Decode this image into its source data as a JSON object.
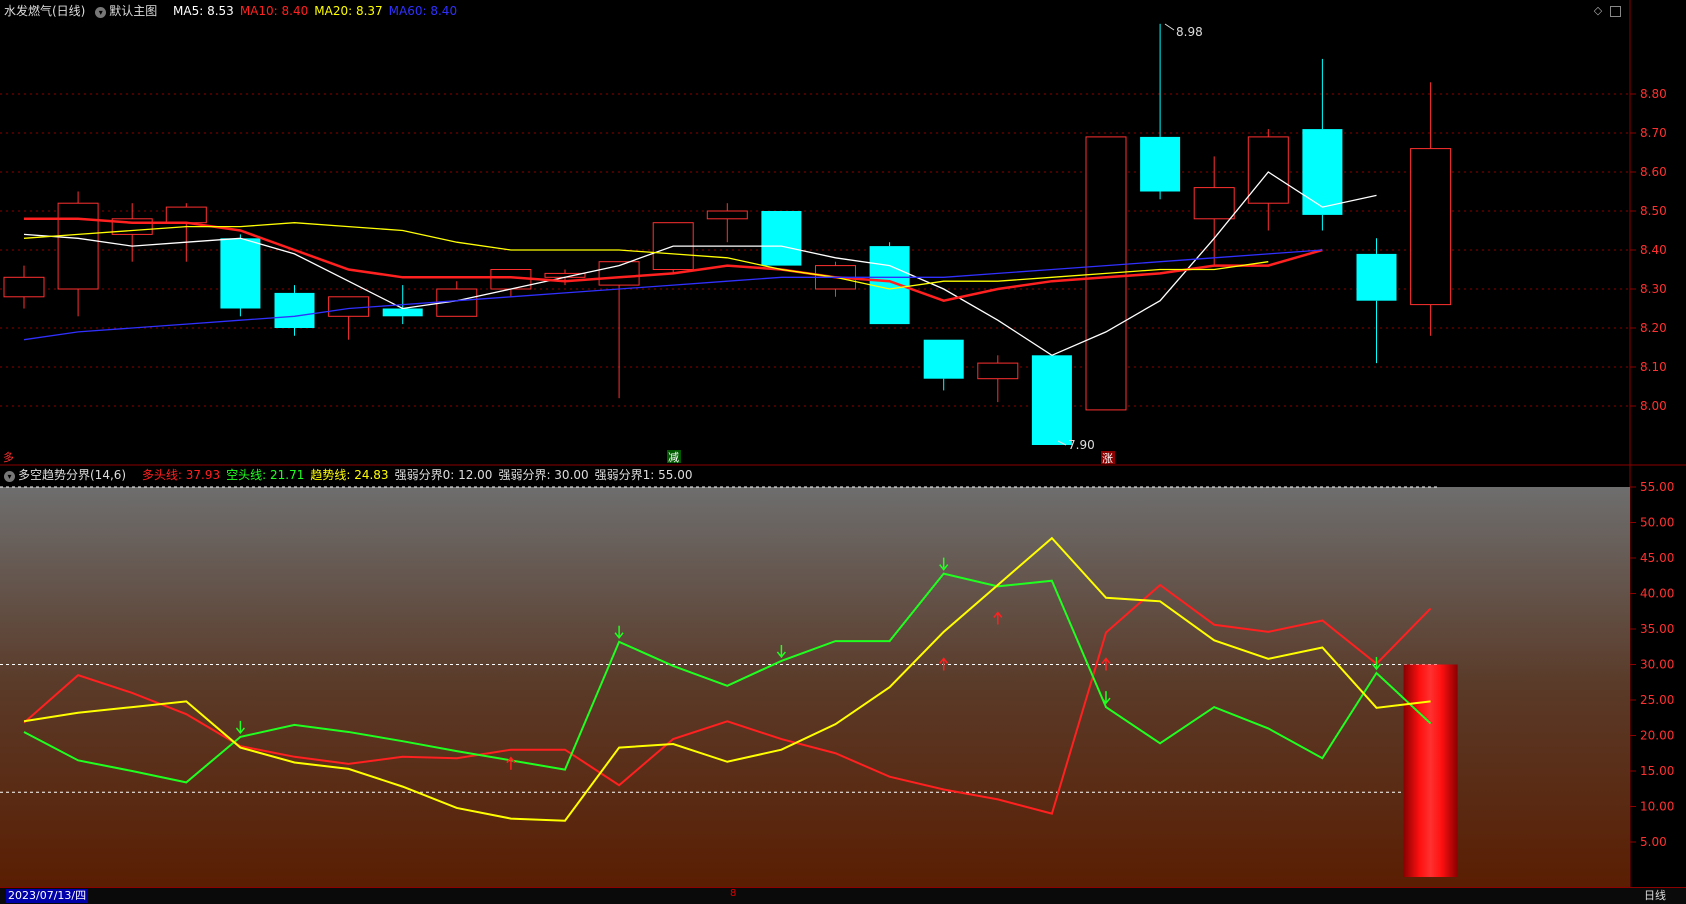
{
  "main_panel": {
    "stock_name": "水发燃气(日线)",
    "template_label": "默认主图",
    "ma": [
      {
        "label": "MA5: 8.53",
        "color": "#ffffff"
      },
      {
        "label": "MA10: 8.40",
        "color": "#ff2020"
      },
      {
        "label": "MA20: 8.37",
        "color": "#ffff00"
      },
      {
        "label": "MA60: 8.40",
        "color": "#3030ff"
      }
    ],
    "high_label": "8.98",
    "low_label": "7.90",
    "marker_left": "多",
    "marker_mid": "减",
    "marker_right": "涨"
  },
  "indicator_panel": {
    "name": "多空趋势分界(14,6)",
    "values": [
      {
        "label": "多头线: 37.93",
        "color": "#ff2020"
      },
      {
        "label": "空头线: 21.71",
        "color": "#20ff20"
      },
      {
        "label": "趋势线: 24.83",
        "color": "#ffff00"
      },
      {
        "label": "强弱分界0: 12.00",
        "color": "#dddddd"
      },
      {
        "label": "强弱分界: 30.00",
        "color": "#dddddd"
      },
      {
        "label": "强弱分界1: 55.00",
        "color": "#dddddd"
      }
    ]
  },
  "bottom": {
    "date": "2023/07/13/四",
    "period": "日线",
    "cursor": "8"
  },
  "colors": {
    "up": "#ff3030",
    "down": "#00ffff",
    "grid": "#8b0000"
  },
  "chart_data": [
    {
      "type": "candlestick",
      "title": "水发燃气(日线)",
      "y_ticks": [
        8.0,
        8.1,
        8.2,
        8.3,
        8.4,
        8.5,
        8.6,
        8.7,
        8.8
      ],
      "ylim": [
        7.88,
        9.0
      ],
      "candles": [
        {
          "o": 8.28,
          "h": 8.36,
          "l": 8.25,
          "c": 8.33
        },
        {
          "o": 8.3,
          "h": 8.55,
          "l": 8.23,
          "c": 8.52
        },
        {
          "o": 8.44,
          "h": 8.52,
          "l": 8.37,
          "c": 8.48
        },
        {
          "o": 8.47,
          "h": 8.52,
          "l": 8.37,
          "c": 8.51
        },
        {
          "o": 8.43,
          "h": 8.44,
          "l": 8.23,
          "c": 8.25
        },
        {
          "o": 8.29,
          "h": 8.31,
          "l": 8.18,
          "c": 8.2
        },
        {
          "o": 8.23,
          "h": 8.28,
          "l": 8.17,
          "c": 8.28
        },
        {
          "o": 8.25,
          "h": 8.31,
          "l": 8.21,
          "c": 8.23
        },
        {
          "o": 8.23,
          "h": 8.32,
          "l": 8.23,
          "c": 8.3
        },
        {
          "o": 8.3,
          "h": 8.35,
          "l": 8.28,
          "c": 8.35
        },
        {
          "o": 8.33,
          "h": 8.35,
          "l": 8.31,
          "c": 8.34
        },
        {
          "o": 8.31,
          "h": 8.37,
          "l": 8.02,
          "c": 8.37
        },
        {
          "o": 8.35,
          "h": 8.47,
          "l": 8.34,
          "c": 8.47
        },
        {
          "o": 8.48,
          "h": 8.52,
          "l": 8.42,
          "c": 8.5
        },
        {
          "o": 8.5,
          "h": 8.5,
          "l": 8.36,
          "c": 8.36
        },
        {
          "o": 8.3,
          "h": 8.37,
          "l": 8.28,
          "c": 8.36
        },
        {
          "o": 8.41,
          "h": 8.42,
          "l": 8.21,
          "c": 8.21
        },
        {
          "o": 8.17,
          "h": 8.17,
          "l": 8.04,
          "c": 8.07
        },
        {
          "o": 8.07,
          "h": 8.13,
          "l": 8.01,
          "c": 8.11
        },
        {
          "o": 8.13,
          "h": 8.13,
          "l": 7.9,
          "c": 7.9
        },
        {
          "o": 7.99,
          "h": 8.69,
          "l": 7.99,
          "c": 8.69
        },
        {
          "o": 8.69,
          "h": 8.98,
          "l": 8.53,
          "c": 8.55
        },
        {
          "o": 8.48,
          "h": 8.64,
          "l": 8.36,
          "c": 8.56
        },
        {
          "o": 8.52,
          "h": 8.71,
          "l": 8.45,
          "c": 8.69
        },
        {
          "o": 8.71,
          "h": 8.89,
          "l": 8.45,
          "c": 8.49
        },
        {
          "o": 8.39,
          "h": 8.43,
          "l": 8.11,
          "c": 8.27
        },
        {
          "o": 8.26,
          "h": 8.83,
          "l": 8.18,
          "c": 8.66
        }
      ],
      "series": [
        {
          "name": "MA5",
          "color": "#ffffff",
          "values": [
            8.44,
            8.43,
            8.41,
            8.42,
            8.43,
            8.39,
            8.32,
            8.25,
            8.27,
            8.3,
            8.33,
            8.36,
            8.41,
            8.41,
            8.41,
            8.38,
            8.36,
            8.3,
            8.22,
            8.13,
            8.19,
            8.27,
            8.43,
            8.6,
            8.51,
            8.54,
            null
          ]
        },
        {
          "name": "MA10",
          "color": "#ff2020",
          "values": [
            8.48,
            8.48,
            8.47,
            8.47,
            8.45,
            8.4,
            8.35,
            8.33,
            8.33,
            8.33,
            8.32,
            8.33,
            8.34,
            8.36,
            8.35,
            8.33,
            8.32,
            8.27,
            8.3,
            8.32,
            8.33,
            8.34,
            8.36,
            8.36,
            8.4,
            null,
            null
          ]
        },
        {
          "name": "MA20",
          "color": "#ffff00",
          "values": [
            8.43,
            8.44,
            8.45,
            8.46,
            8.46,
            8.47,
            8.46,
            8.45,
            8.42,
            8.4,
            8.4,
            8.4,
            8.39,
            8.38,
            8.35,
            8.33,
            8.3,
            8.32,
            8.32,
            8.33,
            8.34,
            8.35,
            8.35,
            8.37,
            null,
            null,
            null
          ]
        },
        {
          "name": "MA60",
          "color": "#3030ff",
          "values": [
            8.17,
            8.19,
            8.2,
            8.21,
            8.22,
            8.23,
            8.25,
            8.26,
            8.27,
            8.28,
            8.29,
            8.3,
            8.31,
            8.32,
            8.33,
            8.33,
            8.33,
            8.33,
            8.34,
            8.35,
            8.36,
            8.37,
            8.38,
            8.39,
            8.4,
            null,
            null
          ]
        }
      ]
    },
    {
      "type": "line",
      "title": "多空趋势分界(14,6)",
      "y_ticks": [
        5.0,
        10.0,
        15.0,
        20.0,
        25.0,
        30.0,
        35.0,
        40.0,
        45.0,
        50.0,
        55.0
      ],
      "ylim": [
        0,
        55
      ],
      "reference_lines": [
        12,
        30,
        55
      ],
      "series": [
        {
          "name": "多头线",
          "color": "#ff2020",
          "values": [
            21.8,
            28.5,
            26.0,
            23.0,
            18.5,
            17.0,
            16.0,
            17.0,
            16.8,
            18.0,
            18.0,
            13.0,
            19.5,
            22.0,
            19.5,
            17.5,
            14.2,
            12.4,
            11.0,
            9.0,
            34.5,
            41.2,
            35.6,
            34.6,
            36.2,
            30.1,
            37.9
          ]
        },
        {
          "name": "空头线",
          "color": "#20ff20",
          "values": [
            20.5,
            16.5,
            15.0,
            13.4,
            19.8,
            21.5,
            20.5,
            19.2,
            17.8,
            16.5,
            15.2,
            33.2,
            29.8,
            27.0,
            30.5,
            33.3,
            33.3,
            42.8,
            41.0,
            41.8,
            24.0,
            18.9,
            24.0,
            21.0,
            16.8,
            28.8,
            21.7
          ]
        },
        {
          "name": "趋势线",
          "color": "#ffff00",
          "values": [
            22.0,
            23.2,
            24.0,
            24.8,
            18.3,
            16.2,
            15.3,
            12.8,
            9.8,
            8.3,
            8.0,
            18.3,
            18.8,
            16.3,
            18.0,
            21.6,
            26.8,
            34.6,
            41.2,
            47.8,
            39.4,
            38.9,
            33.4,
            30.8,
            32.4,
            23.9,
            24.8
          ]
        }
      ],
      "arrows_down": [
        4,
        11,
        14,
        17,
        20,
        25
      ],
      "arrows_up": [
        9,
        17,
        18,
        20
      ],
      "bar_last": 30.0
    }
  ]
}
